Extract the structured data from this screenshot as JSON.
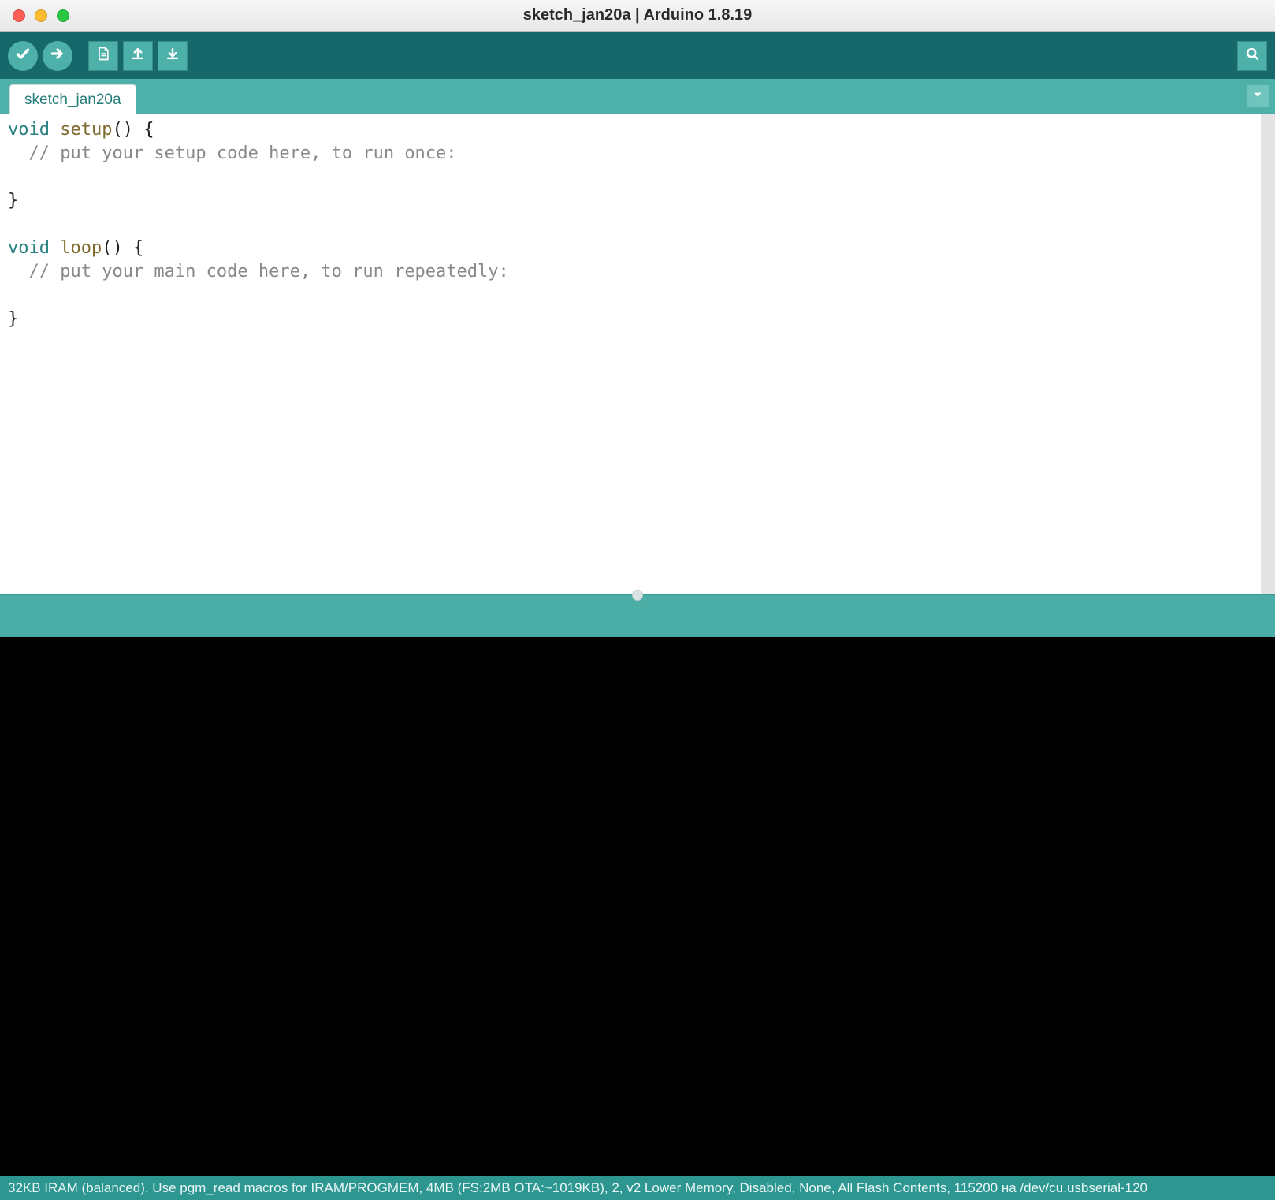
{
  "window": {
    "title": "sketch_jan20a | Arduino 1.8.19"
  },
  "toolbar": {
    "verify": "verify-icon",
    "upload": "upload-icon",
    "new": "new-file-icon",
    "open": "open-file-icon",
    "save": "save-icon",
    "serial_monitor": "serial-monitor-icon"
  },
  "tabs": {
    "items": [
      {
        "label": "sketch_jan20a"
      }
    ]
  },
  "editor": {
    "lines": [
      {
        "kw": "void ",
        "fn": "setup",
        "rest": "() {"
      },
      {
        "com": "  // put your setup code here, to run once:"
      },
      {
        "plain": ""
      },
      {
        "plain": "}"
      },
      {
        "plain": ""
      },
      {
        "kw": "void ",
        "fn": "loop",
        "rest": "() {"
      },
      {
        "com": "  // put your main code here, to run repeatedly:"
      },
      {
        "plain": ""
      },
      {
        "plain": "}"
      }
    ]
  },
  "footer": {
    "status": "32KB IRAM (balanced), Use pgm_read macros for IRAM/PROGMEM, 4MB (FS:2MB OTA:~1019KB), 2, v2 Lower Memory, Disabled, None, All Flash Contents, 115200 на /dev/cu.usbserial-120"
  },
  "colors": {
    "teal_dark": "#17686b",
    "teal_mid": "#4db0a9",
    "teal_status": "#2d9690"
  }
}
